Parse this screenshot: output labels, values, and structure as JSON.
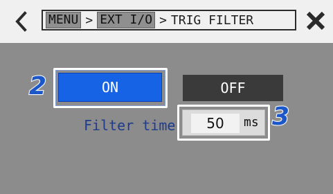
{
  "header": {
    "breadcrumb": [
      "MENU",
      "EXT I/O"
    ],
    "separator": ">",
    "current": "TRIG FILTER"
  },
  "callouts": {
    "step2": "2",
    "step3": "3"
  },
  "buttons": {
    "on_label": "ON",
    "off_label": "OFF",
    "selected": "ON"
  },
  "filter": {
    "label": "Filter time",
    "value": "50",
    "unit": "ms"
  },
  "icons": {
    "back": "chevron-left-icon",
    "close": "close-x-icon"
  },
  "colors": {
    "accent_blue": "#1763e6",
    "panel_gray": "#8c8c8c",
    "off_button": "#3a3a3a",
    "label_blue": "#1e3b8c"
  }
}
